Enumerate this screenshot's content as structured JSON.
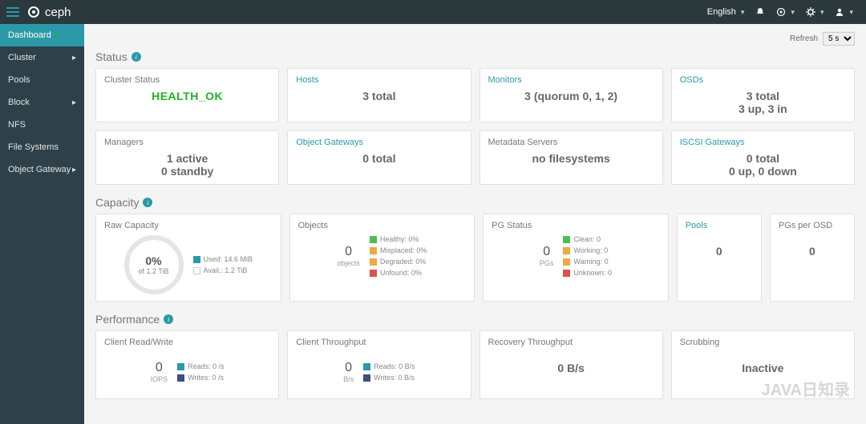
{
  "topbar": {
    "brand": "ceph",
    "lang": "English",
    "notif": "🔔",
    "tasks": "◎",
    "settings": "⚙",
    "user": "👤"
  },
  "refresh": {
    "label": "Refresh",
    "value": "5 s"
  },
  "sidebar": {
    "items": [
      {
        "label": "Dashboard",
        "active": true,
        "chev": false,
        "tick": true
      },
      {
        "label": "Cluster",
        "chev": true
      },
      {
        "label": "Pools",
        "chev": false
      },
      {
        "label": "Block",
        "chev": true
      },
      {
        "label": "NFS",
        "chev": false
      },
      {
        "label": "File Systems",
        "chev": false
      },
      {
        "label": "Object Gateway",
        "chev": true
      }
    ]
  },
  "sections": {
    "status": {
      "heading": "Status",
      "cards": [
        {
          "title": "Cluster Status",
          "body": "HEALTH_OK",
          "kind": "health"
        },
        {
          "title": "Hosts",
          "body": "3 total",
          "link": true
        },
        {
          "title": "Monitors",
          "body": "3 (quorum 0, 1, 2)",
          "link": true
        },
        {
          "title": "OSDs",
          "body": "3 total",
          "body2": "3 up, 3 in",
          "link": true
        },
        {
          "title": "Managers",
          "body": "1 active",
          "body2": "0 standby"
        },
        {
          "title": "Object Gateways",
          "body": "0 total",
          "link": true
        },
        {
          "title": "Metadata Servers",
          "body": "no filesystems"
        },
        {
          "title": "ISCSI Gateways",
          "body": "0 total",
          "body2": "0 up, 0 down",
          "link": true
        }
      ]
    },
    "capacity": {
      "heading": "Capacity",
      "cards": {
        "raw": {
          "title": "Raw Capacity",
          "pct": "0%",
          "of": "of 1.2 TiB",
          "legend": [
            {
              "c": "#2b99a8",
              "t": "Used: 14.6 MiB"
            },
            {
              "c": "#ffffff",
              "t": "Avail.: 1.2 TiB",
              "border": true
            }
          ]
        },
        "objects": {
          "title": "Objects",
          "val": "0",
          "unit": "objects",
          "legend": [
            {
              "c": "#4fbf4f",
              "t": "Healthy: 0%"
            },
            {
              "c": "#f0a840",
              "t": "Misplaced: 0%"
            },
            {
              "c": "#f0a840",
              "t": "Degraded: 0%"
            },
            {
              "c": "#d9534f",
              "t": "Unfound: 0%"
            }
          ]
        },
        "pg": {
          "title": "PG Status",
          "val": "0",
          "unit": "PGs",
          "legend": [
            {
              "c": "#4fbf4f",
              "t": "Clean: 0"
            },
            {
              "c": "#f0a840",
              "t": "Working: 0"
            },
            {
              "c": "#f0a840",
              "t": "Warning: 0"
            },
            {
              "c": "#d9534f",
              "t": "Unknown: 0"
            }
          ]
        },
        "pools": {
          "title": "Pools",
          "val": "0",
          "link": true
        },
        "pgsper": {
          "title": "PGs per OSD",
          "val": "0"
        }
      }
    },
    "perf": {
      "heading": "Performance",
      "cards": {
        "rw": {
          "title": "Client Read/Write",
          "val": "0",
          "unit": "IOPS",
          "legend": [
            {
              "c": "#2b99a8",
              "t": "Reads: 0 /s"
            },
            {
              "c": "#3b4d82",
              "t": "Writes: 0 /s"
            }
          ]
        },
        "tp": {
          "title": "Client Throughput",
          "val": "0",
          "unit": "B/s",
          "legend": [
            {
              "c": "#2b99a8",
              "t": "Reads: 0 B/s"
            },
            {
              "c": "#3b4d82",
              "t": "Writes: 0 B/s"
            }
          ]
        },
        "rec": {
          "title": "Recovery Throughput",
          "val": "0 B/s"
        },
        "scrub": {
          "title": "Scrubbing",
          "val": "Inactive"
        }
      }
    }
  },
  "watermark": "JAVA日知录"
}
